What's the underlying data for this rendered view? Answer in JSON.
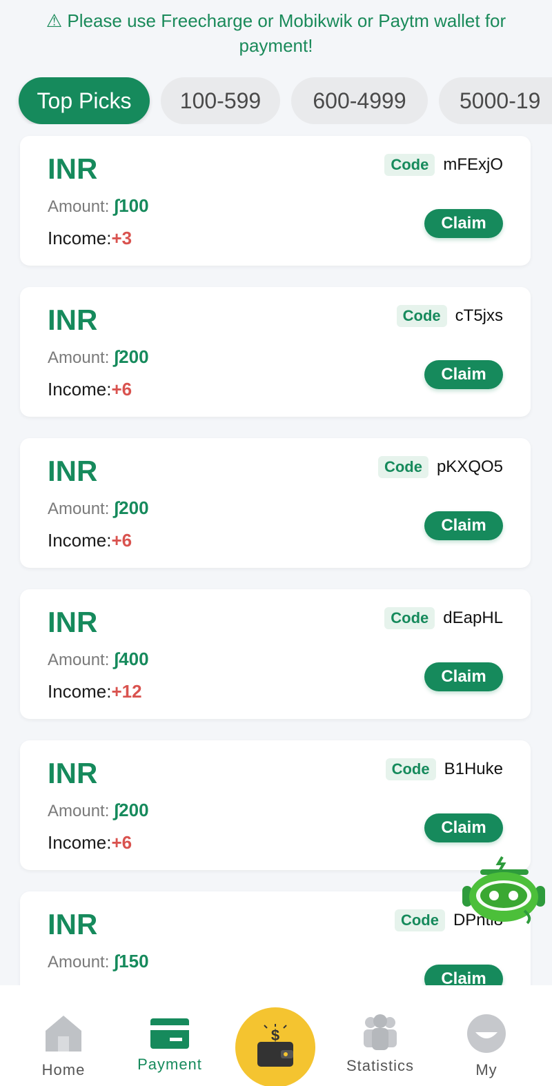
{
  "notice": "⚠ Please use Freecharge or Mobikwik or Paytm wallet for payment!",
  "tabs": [
    {
      "label": "Top Picks",
      "active": true
    },
    {
      "label": "100-599",
      "active": false
    },
    {
      "label": "600-4999",
      "active": false
    },
    {
      "label": "5000-19",
      "active": false
    }
  ],
  "labels": {
    "amount": "Amount:",
    "income": "Income:",
    "code": "Code",
    "claim": "Claim"
  },
  "offers": [
    {
      "currency": "INR",
      "amount": "∫100",
      "income": "+3",
      "code": "mFExjO"
    },
    {
      "currency": "INR",
      "amount": "∫200",
      "income": "+6",
      "code": "cT5jxs"
    },
    {
      "currency": "INR",
      "amount": "∫200",
      "income": "+6",
      "code": "pKXQO5"
    },
    {
      "currency": "INR",
      "amount": "∫400",
      "income": "+12",
      "code": "dEapHL"
    },
    {
      "currency": "INR",
      "amount": "∫200",
      "income": "+6",
      "code": "B1Huke"
    },
    {
      "currency": "INR",
      "amount": "∫150",
      "code": "DPnti8"
    }
  ],
  "nav": {
    "home": "Home",
    "payment": "Payment",
    "statistics": "Statistics",
    "my": "My"
  },
  "colors": {
    "accent": "#168a5c",
    "income": "#d9534f",
    "wallet": "#f4c430"
  }
}
